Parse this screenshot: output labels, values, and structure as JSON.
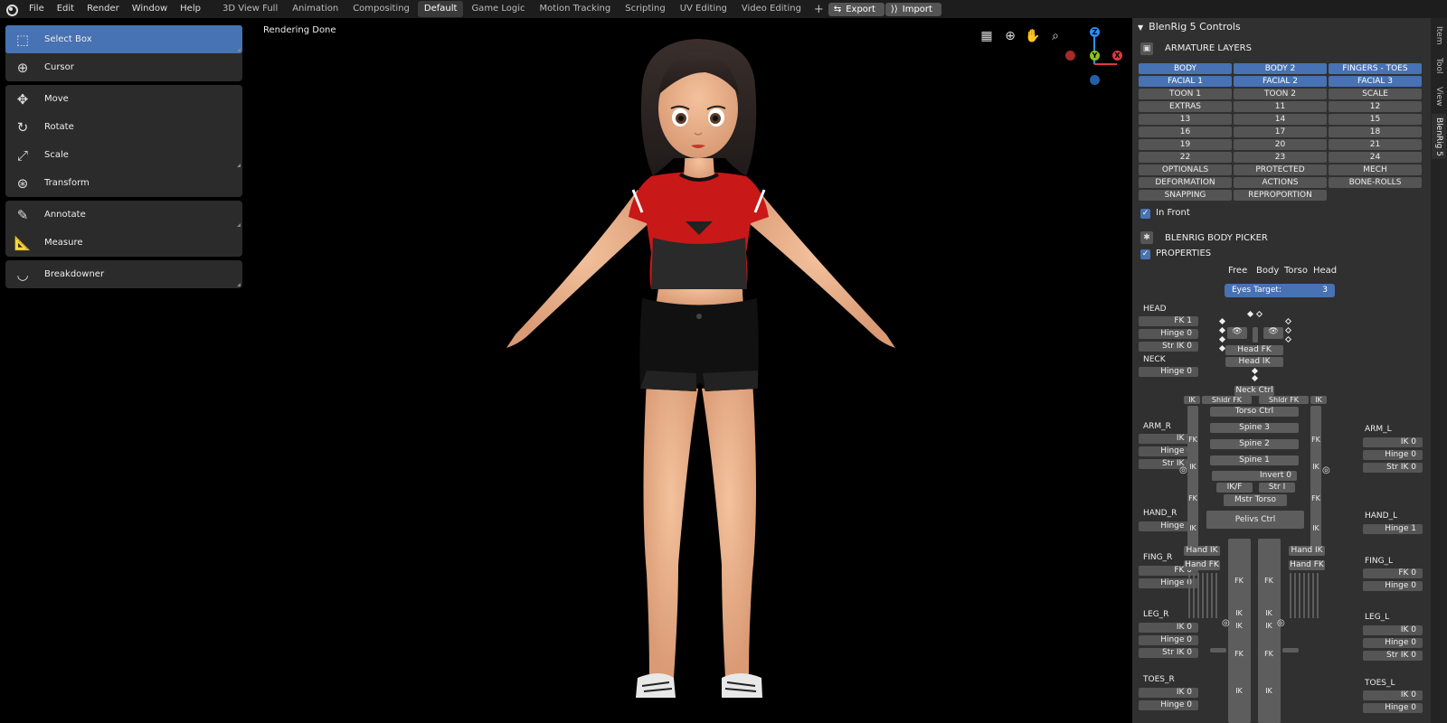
{
  "topbar": {
    "menus": [
      "File",
      "Edit",
      "Render",
      "Window",
      "Help"
    ],
    "workspaces": [
      "3D View Full",
      "Animation",
      "Compositing",
      "Default",
      "Game Logic",
      "Motion Tracking",
      "Scripting",
      "UV Editing",
      "Video Editing"
    ],
    "active_workspace": "Default",
    "export_label": "Export",
    "import_label": "Import"
  },
  "viewport": {
    "status": "Rendering Done",
    "axes": {
      "x": "X",
      "y": "Y",
      "z": "Z"
    }
  },
  "toolbar": {
    "tools": [
      {
        "label": "Select Box",
        "icon": "select-box-icon"
      },
      {
        "label": "Cursor",
        "icon": "cursor-icon"
      },
      {
        "label": "Move",
        "icon": "move-icon"
      },
      {
        "label": "Rotate",
        "icon": "rotate-icon"
      },
      {
        "label": "Scale",
        "icon": "scale-icon"
      },
      {
        "label": "Transform",
        "icon": "transform-icon"
      },
      {
        "label": "Annotate",
        "icon": "annotate-icon"
      },
      {
        "label": "Measure",
        "icon": "measure-icon"
      },
      {
        "label": "Breakdowner",
        "icon": "breakdowner-icon"
      }
    ]
  },
  "sidebar_tabs": [
    "Item",
    "Tool",
    "View",
    "BlenRig 5"
  ],
  "panel": {
    "title": "BlenRig 5 Controls",
    "armature_layers_title": "ARMATURE LAYERS",
    "layers": [
      {
        "label": "BODY",
        "on": true
      },
      {
        "label": "BODY 2",
        "on": true
      },
      {
        "label": "FINGERS - TOES",
        "on": true
      },
      {
        "label": "FACIAL 1",
        "on": true
      },
      {
        "label": "FACIAL 2",
        "on": true
      },
      {
        "label": "FACIAL 3",
        "on": true
      },
      {
        "label": "TOON 1",
        "on": false
      },
      {
        "label": "TOON 2",
        "on": false
      },
      {
        "label": "SCALE",
        "on": false
      },
      {
        "label": "EXTRAS",
        "on": false
      },
      {
        "label": "11",
        "on": false
      },
      {
        "label": "12",
        "on": false
      },
      {
        "label": "13",
        "on": false
      },
      {
        "label": "14",
        "on": false
      },
      {
        "label": "15",
        "on": false
      },
      {
        "label": "16",
        "on": false
      },
      {
        "label": "17",
        "on": false
      },
      {
        "label": "18",
        "on": false
      },
      {
        "label": "19",
        "on": false
      },
      {
        "label": "20",
        "on": false
      },
      {
        "label": "21",
        "on": false
      },
      {
        "label": "22",
        "on": false
      },
      {
        "label": "23",
        "on": false
      },
      {
        "label": "24",
        "on": false
      },
      {
        "label": "OPTIONALS",
        "on": false
      },
      {
        "label": "PROTECTED",
        "on": false
      },
      {
        "label": "MECH",
        "on": false
      },
      {
        "label": "DEFORMATION",
        "on": false
      },
      {
        "label": "ACTIONS",
        "on": false
      },
      {
        "label": "BONE-ROLLS",
        "on": false
      },
      {
        "label": "SNAPPING",
        "on": false
      },
      {
        "label": "REPROPORTION",
        "on": false
      }
    ],
    "in_front_label": "In Front",
    "body_picker_title": "BLENRIG BODY PICKER",
    "properties_label": "PROPERTIES",
    "picker_tabs": [
      "Free",
      "Body",
      "Torso",
      "Head"
    ],
    "eyes_target_label": "Eyes Target:",
    "eyes_target_value": "3",
    "head": {
      "label": "HEAD",
      "fk": "FK 1",
      "hinge": "Hinge 0",
      "str_ik": "Str IK 0"
    },
    "neck": {
      "label": "NECK",
      "hinge": "Hinge 0"
    },
    "arm_r": {
      "label": "ARM_R",
      "ik": "IK 0",
      "hinge": "Hinge 0",
      "str_ik": "Str IK 0"
    },
    "arm_l": {
      "label": "ARM_L",
      "ik": "IK 0",
      "hinge": "Hinge 0",
      "str_ik": "Str IK 0"
    },
    "hand_r": {
      "label": "HAND_R",
      "hinge": "Hinge 1"
    },
    "hand_l": {
      "label": "HAND_L",
      "hinge": "Hinge 1"
    },
    "fing_r": {
      "label": "FING_R",
      "fk": "FK 0",
      "hinge": "Hinge 0"
    },
    "fing_l": {
      "label": "FING_L",
      "fk": "FK 0",
      "hinge": "Hinge 0"
    },
    "leg_r": {
      "label": "LEG_R",
      "ik": "IK 0",
      "hinge": "Hinge 0",
      "str_ik": "Str IK 0"
    },
    "leg_l": {
      "label": "LEG_L",
      "ik": "IK 0",
      "hinge": "Hinge 0",
      "str_ik": "Str IK 0"
    },
    "toes_r": {
      "label": "TOES_R",
      "ik": "IK 0",
      "hinge": "Hinge 0"
    },
    "toes_l": {
      "label": "TOES_L",
      "ik": "IK 0",
      "hinge": "Hinge 0"
    },
    "picker": {
      "head_fk": "Head FK",
      "head_ik": "Head IK",
      "neck_ctrl": "Neck Ctrl",
      "shldr_fk_r": "Shldr FK",
      "shldr_fk_l": "Shldr FK",
      "ik": "IK",
      "fk": "FK",
      "torso_ctrl": "Torso Ctrl",
      "spine3": "Spine 3",
      "spine2": "Spine 2",
      "spine1": "Spine 1",
      "invert": "Invert 0",
      "ikf": "IK/F",
      "str_i": "Str I",
      "mstr_torso": "Mstr Torso",
      "pelvis_ctrl": "Pelivs Ctrl",
      "hand_ik": "Hand IK",
      "hand_fk": "Hand FK"
    }
  },
  "colors": {
    "accent": "#4772b3",
    "x_axis": "#e0393e",
    "y_axis": "#8bc31d",
    "z_axis": "#2c8fff"
  }
}
